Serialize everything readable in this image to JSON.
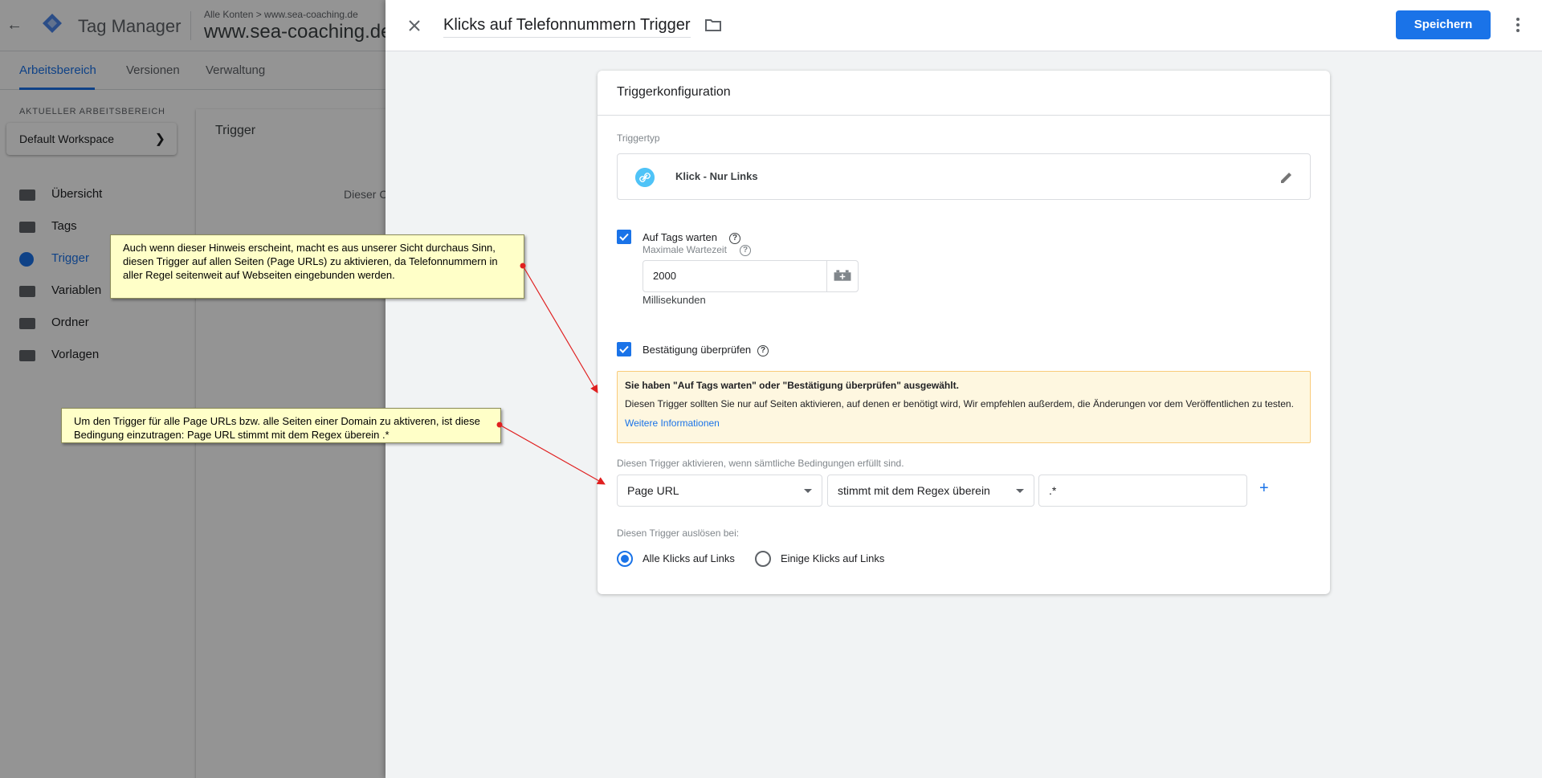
{
  "background": {
    "product_name": "Tag Manager",
    "breadcrumb": "Alle Konten > www.sea-coaching.de",
    "container_name": "www.sea-coaching.de",
    "tabs": [
      {
        "label": "Arbeitsbereich",
        "active": true
      },
      {
        "label": "Versionen",
        "active": false
      },
      {
        "label": "Verwaltung",
        "active": false
      }
    ],
    "workspace_label": "AKTUELLER ARBEITSBEREICH",
    "workspace_name": "Default Workspace",
    "nav": [
      {
        "label": "Übersicht",
        "icon": "briefcase-icon",
        "active": false
      },
      {
        "label": "Tags",
        "icon": "tag-icon",
        "active": false
      },
      {
        "label": "Trigger",
        "icon": "trigger-icon",
        "active": true
      },
      {
        "label": "Variablen",
        "icon": "variables-icon",
        "active": false
      },
      {
        "label": "Ordner",
        "icon": "folder-icon",
        "active": false
      },
      {
        "label": "Vorlagen",
        "icon": "template-icon",
        "active": false
      }
    ],
    "card_title": "Trigger",
    "card_text": "Dieser C"
  },
  "panel": {
    "trigger_name": "Klicks auf Telefonnummern Trigger",
    "save_label": "Speichern",
    "config_title": "Triggerkonfiguration",
    "type_label": "Triggertyp",
    "type_name": "Klick - Nur Links",
    "wait_for_tags": {
      "label": "Auf Tags warten",
      "checked": true
    },
    "max_wait": {
      "label": "Maximale Wartezeit",
      "value": "2000",
      "unit": "Millisekunden"
    },
    "check_validation": {
      "label": "Bestätigung überprüfen",
      "checked": true
    },
    "warning": {
      "title": "Sie haben \"Auf Tags warten\" oder \"Bestätigung überprüfen\" ausgewählt.",
      "text": "Diesen Trigger sollten Sie nur auf Seiten aktivieren, auf denen er benötigt wird, Wir empfehlen außerdem, die Änderungen vor dem Veröffentlichen zu testen.",
      "link": "Weitere Informationen"
    },
    "condition_label": "Diesen Trigger aktivieren, wenn sämtliche Bedingungen erfüllt sind.",
    "condition": {
      "variable": "Page URL",
      "operator": "stimmt mit dem Regex überein",
      "value": ".*"
    },
    "add_label": "+",
    "fire_label": "Diesen Trigger auslösen bei:",
    "fire_options": [
      {
        "label": "Alle Klicks auf Links",
        "selected": true
      },
      {
        "label": "Einige Klicks auf Links",
        "selected": false
      }
    ]
  },
  "annotations": {
    "note1": "Auch wenn dieser Hinweis erscheint, macht es aus unserer Sicht durchaus Sinn, diesen Trigger auf allen Seiten (Page URLs) zu aktivieren, da Telefonnummern in aller Regel seitenweit auf Webseiten eingebunden werden.",
    "note2": "Um den Trigger für alle Page URLs bzw. alle Seiten einer Domain zu aktiveren, ist diese Bedingung einzutragen: Page URL stimmt mit dem Regex überein .*"
  },
  "colors": {
    "accent": "#1a73e8",
    "note_bg": "#ffffc8",
    "warning_bg": "#fef7e0",
    "arrow": "#e02020"
  }
}
